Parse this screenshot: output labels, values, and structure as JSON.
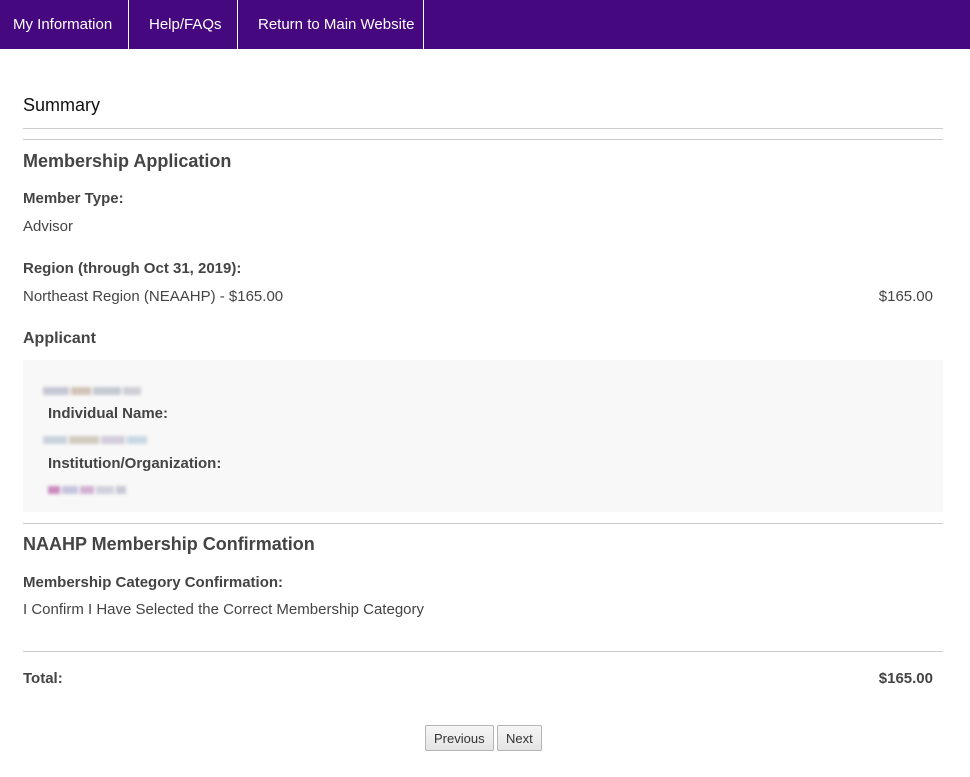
{
  "nav": {
    "items": [
      {
        "label": "My Information"
      },
      {
        "label": "Help/FAQs"
      },
      {
        "label": "Return to Main Website"
      }
    ]
  },
  "summary": {
    "title": "Summary"
  },
  "membership_application": {
    "title": "Membership Application",
    "member_type_label": "Member Type:",
    "member_type_value": "Advisor",
    "region_label": "Region (through Oct 31, 2019):",
    "region_value": "Northeast Region (NEAAHP) - $165.00",
    "region_amount": "$165.00"
  },
  "applicant": {
    "title": "Applicant",
    "individual_name_label": "Individual Name:",
    "institution_label": "Institution/Organization:"
  },
  "confirmation": {
    "title": "NAAHP Membership Confirmation",
    "category_label": "Membership Category Confirmation:",
    "category_value": "I Confirm I Have Selected the Correct Membership Category"
  },
  "total": {
    "label": "Total:",
    "amount": "$165.00"
  },
  "buttons": {
    "previous": "Previous",
    "next": "Next"
  },
  "colors": {
    "nav_background": "#46087e",
    "nav_text": "#ffffff",
    "applicant_box_background": "#f8f8f8"
  }
}
